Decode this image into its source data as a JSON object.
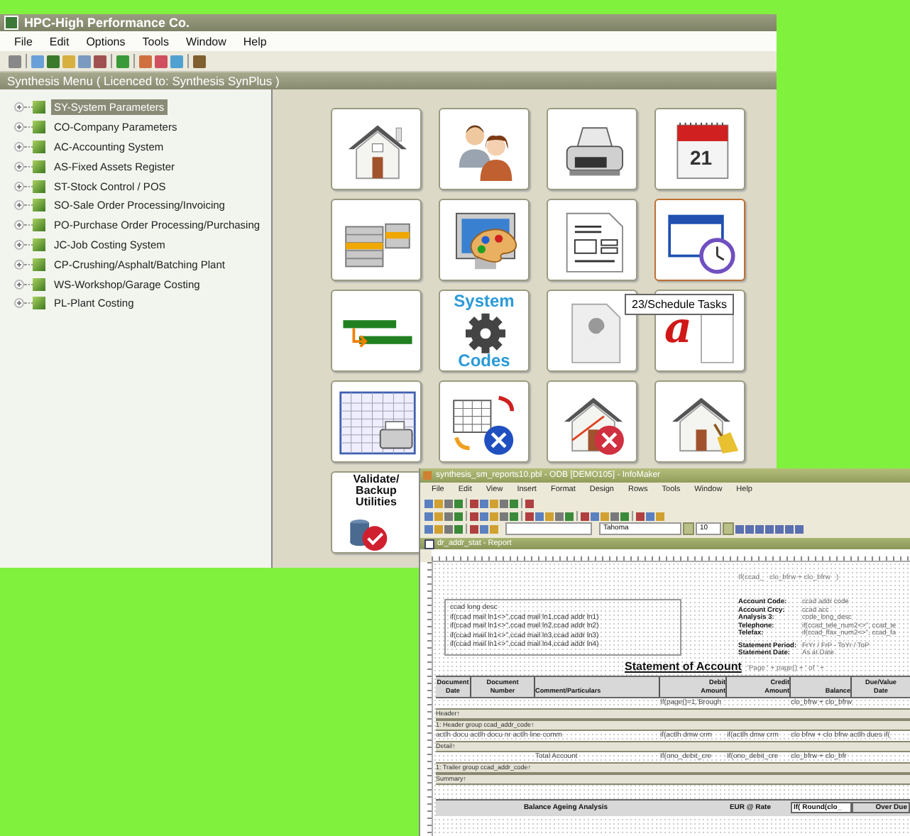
{
  "main_window": {
    "title": "HPC-High Performance Co.",
    "menu": [
      "File",
      "Edit",
      "Options",
      "Tools",
      "Window",
      "Help"
    ],
    "panel_title": "Synthesis Menu ( Licenced to: Synthesis SynPlus )",
    "tree": [
      {
        "label": "SY-System Parameters",
        "selected": true,
        "expanded": false
      },
      {
        "label": "CO-Company Parameters",
        "selected": false,
        "expanded": false
      },
      {
        "label": "AC-Accounting System",
        "selected": false,
        "expanded": false
      },
      {
        "label": "AS-Fixed Assets Register",
        "selected": false,
        "expanded": false
      },
      {
        "label": "ST-Stock Control / POS",
        "selected": false,
        "expanded": false
      },
      {
        "label": "SO-Sale Order Processing/Invoicing",
        "selected": false,
        "expanded": false
      },
      {
        "label": "PO-Purchase Order Processing/Purchasing",
        "selected": false,
        "expanded": false
      },
      {
        "label": "JC-Job Costing System",
        "selected": false,
        "expanded": false
      },
      {
        "label": "CP-Crushing/Asphalt/Batching Plant",
        "selected": false,
        "expanded": false
      },
      {
        "label": "WS-Workshop/Garage Costing",
        "selected": false,
        "expanded": false
      },
      {
        "label": "PL-Plant Costing",
        "selected": false,
        "expanded": false
      }
    ],
    "tiles": [
      {
        "hovered": false
      },
      {
        "hovered": false
      },
      {
        "hovered": false
      },
      {
        "hovered": false,
        "lines": [
          "21"
        ]
      },
      {
        "hovered": false
      },
      {
        "hovered": false
      },
      {
        "hovered": false
      },
      {
        "hovered": true
      },
      {
        "hovered": false
      },
      {
        "hovered": false,
        "lines": [
          "System",
          "Codes"
        ]
      },
      {
        "hovered": false
      },
      {
        "hovered": false,
        "lines": [
          "a"
        ]
      },
      {
        "hovered": false
      },
      {
        "hovered": false
      },
      {
        "hovered": false
      },
      {
        "hovered": false
      },
      {
        "hovered": false,
        "lines": [
          "Validate/",
          "Backup",
          "Utilities"
        ]
      }
    ],
    "tooltip": "23/Schedule Tasks"
  },
  "report_window": {
    "title": "synthesis_sm_reports10.pbl - ODB [DEMO105] - InfoMaker",
    "menu": [
      "File",
      "Edit",
      "View",
      "Insert",
      "Format",
      "Design",
      "Rows",
      "Tools",
      "Window",
      "Help"
    ],
    "font_name": "Tahoma",
    "font_size": "10",
    "document_title": "dr_addr_stat - Report",
    "header_note": "If(ccad_   clo_bfrw + clo_bfrw   )",
    "address_lines": [
      "ccad long desc",
      "if(ccad mail ln1<>'',ccad mail ln1,ccad addr ln1)",
      "if(ccad mail ln1<>'',ccad mail ln2,ccad addr ln2)",
      "if(ccad mail ln1<>'',ccad mail ln3,ccad addr ln3)",
      "if(ccad mail ln1<>'',ccad mail ln4,ccad addr ln4)"
    ],
    "account_fields": [
      {
        "label": "Account Code:",
        "value": "ccad addr code"
      },
      {
        "label": "Account Crcy:",
        "value": "ccad acc"
      },
      {
        "label": "Analysis 3:",
        "value": "code_long_desc"
      },
      {
        "label": "Telephone:",
        "value": "if(ccad_tele_num2<>'', ccad_te"
      },
      {
        "label": "Telefax:",
        "value": "if(ccad_ffax_num2<>'', ccad_fa"
      }
    ],
    "statement_fields": [
      {
        "label": "Statement Period:",
        "value": "FrYr / FrP  -  ToYr / ToP"
      },
      {
        "label": "Statement Date:",
        "value": "As at Date"
      }
    ],
    "statement_title": "Statement of Account",
    "page_expr": "'Page ' + page() + ' of ' +",
    "columns": [
      [
        "Document",
        "Date"
      ],
      [
        "Document",
        "Number"
      ],
      [
        "Comment/Particulars"
      ],
      [
        "Debit",
        "Amount"
      ],
      [
        "Credit",
        "Amount"
      ],
      [
        "Balance"
      ],
      [
        "Due/Value",
        "Date"
      ]
    ],
    "bands": [
      {
        "kind": "row",
        "cells": [
          "If(page()=1,'Brough",
          "clo_bfrw + clo_bfrw"
        ]
      },
      {
        "kind": "band",
        "label": "Header↑"
      },
      {
        "kind": "band",
        "label": "1: Header group ccad_addr_code↑"
      },
      {
        "kind": "row",
        "cells": [
          "actlh docu actlh docu nr actlh line comm",
          "if(actlh dmw crm",
          "if(actlh dmw crm",
          "clo bfrw + clo bfrw actlh dues if("
        ]
      },
      {
        "kind": "band",
        "label": "Detail↑"
      },
      {
        "kind": "row",
        "cells": [
          "Total Account",
          "If(ono_debit_cre",
          "If(ono_debit_cre",
          "clo_bfrw + clo_bfr"
        ]
      },
      {
        "kind": "band",
        "label": "1: Trailer group ccad_addr_code↑"
      },
      {
        "kind": "band",
        "label": "Summary↑"
      }
    ],
    "ageing": {
      "title": "Balance Ageing Analysis",
      "rate": "EUR @ Rate",
      "round": "If( Round(clo_",
      "over_due": "Over Due"
    }
  }
}
